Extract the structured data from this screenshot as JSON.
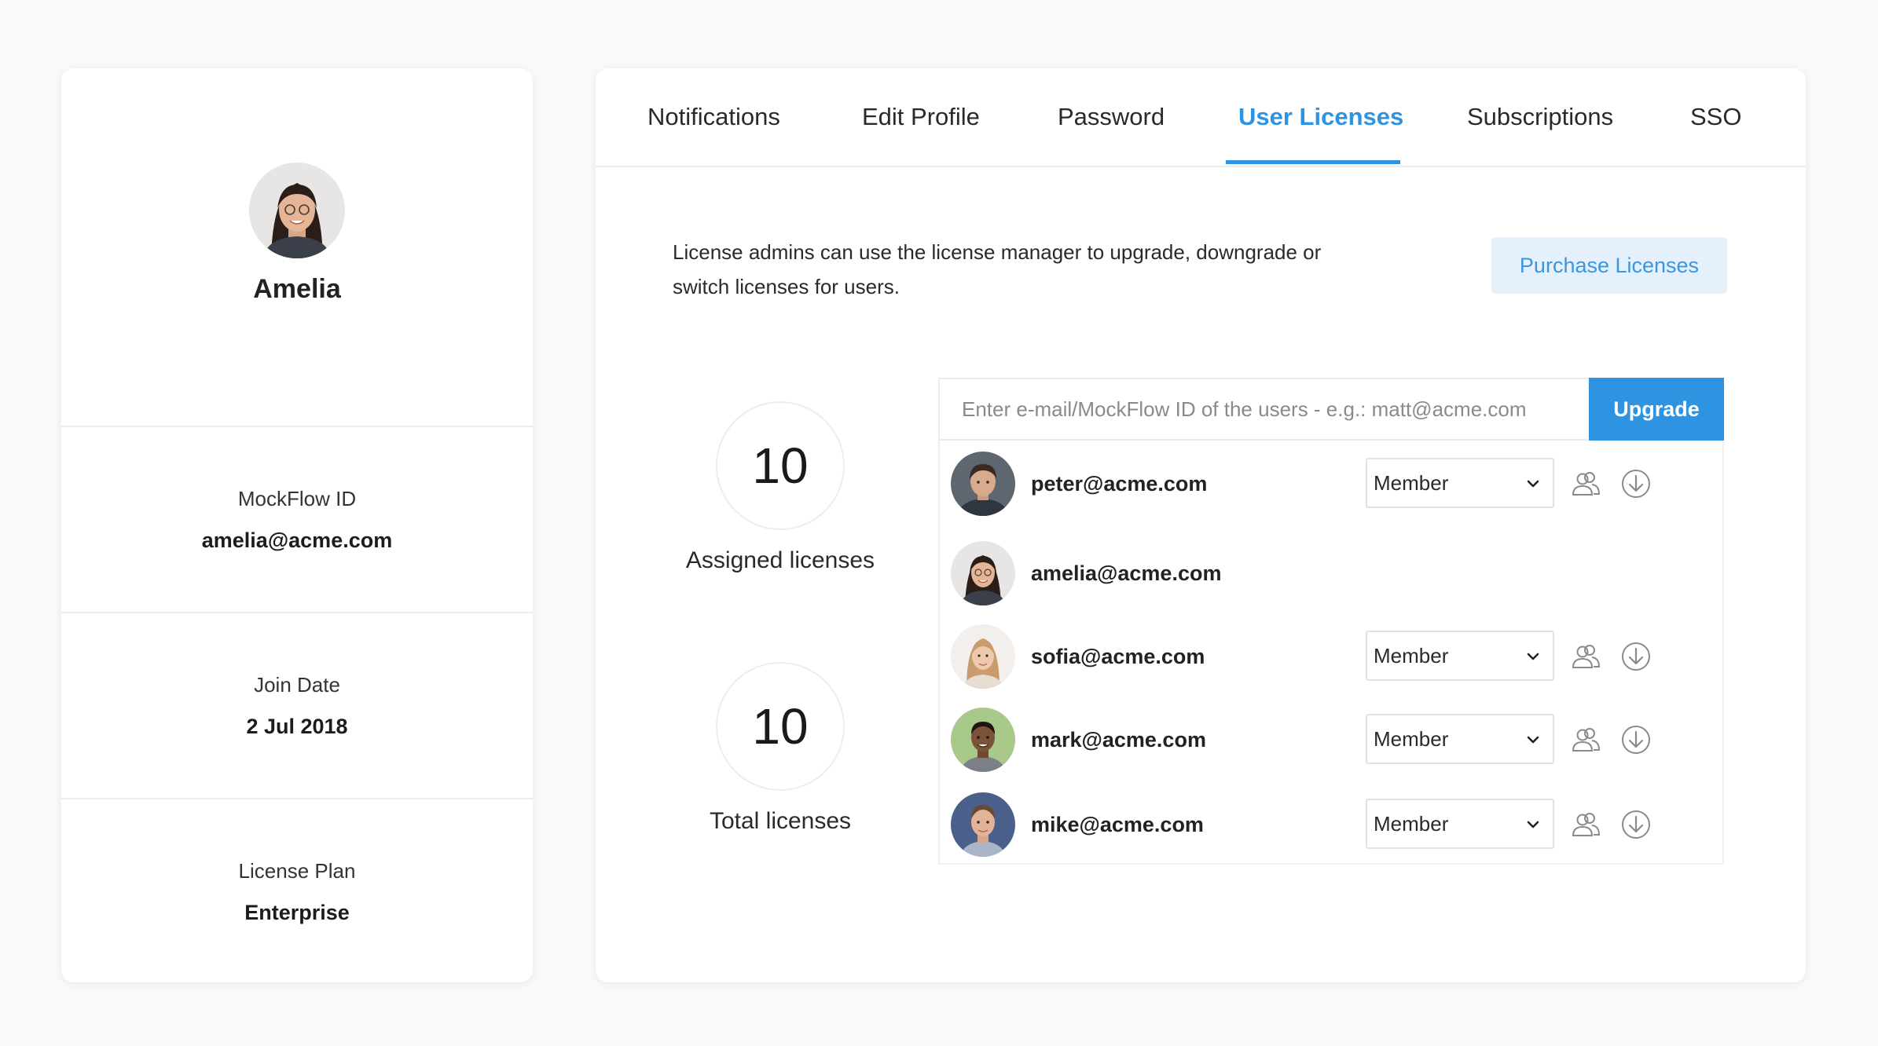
{
  "profile": {
    "name": "Amelia",
    "sections": [
      {
        "label": "MockFlow ID",
        "value": "amelia@acme.com"
      },
      {
        "label": "Join Date",
        "value": "2 Jul 2018"
      },
      {
        "label": "License Plan",
        "value": "Enterprise"
      }
    ]
  },
  "tabs": [
    {
      "label": "Notifications"
    },
    {
      "label": "Edit Profile"
    },
    {
      "label": "Password"
    },
    {
      "label": "User Licenses"
    },
    {
      "label": "Subscriptions"
    },
    {
      "label": "SSO"
    }
  ],
  "active_tab": "User Licenses",
  "licenses": {
    "description": "License admins can use the license manager to upgrade, downgrade or switch licenses for users.",
    "purchase_label": "Purchase Licenses",
    "assigned_count": "10",
    "assigned_label": "Assigned licenses",
    "total_count": "10",
    "total_label": "Total licenses",
    "input_placeholder": "Enter e-mail/MockFlow ID of the users - e.g.: matt@acme.com",
    "upgrade_label": "Upgrade"
  },
  "users": [
    {
      "email": "peter@acme.com",
      "role": "Member"
    },
    {
      "email": "amelia@acme.com"
    },
    {
      "email": "sofia@acme.com",
      "role": "Member"
    },
    {
      "email": "mark@acme.com",
      "role": "Member"
    },
    {
      "email": "mike@acme.com",
      "role": "Member"
    }
  ],
  "colors": {
    "accent": "#2e93e0",
    "purchase_bg": "#e4f1fc",
    "page_bg": "#f9f9f9"
  },
  "icons": {
    "row_action_1": "users-icon",
    "row_action_2": "download-icon",
    "select_arrow": "chevron-down-icon"
  }
}
